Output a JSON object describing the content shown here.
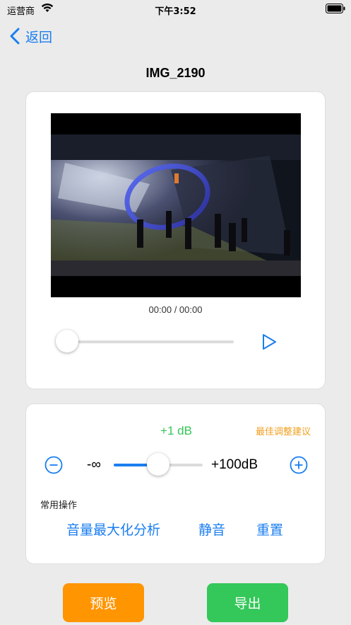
{
  "status_bar": {
    "carrier": "运营商",
    "time": "下午3:52"
  },
  "nav": {
    "back_label": "返回"
  },
  "page": {
    "title": "IMG_2190"
  },
  "player": {
    "timecode": "00:00 / 00:00",
    "progress": 0
  },
  "volume": {
    "gain_label": "+1 dB",
    "best_suggestion": "最佳调整建议",
    "min_label": "-∞",
    "max_label": "+100dB",
    "slider_fraction": 0.5,
    "common_ops_label": "常用操作",
    "actions": [
      "音量最大化分析",
      "静音",
      "重置"
    ]
  },
  "buttons": {
    "preview": "预览",
    "export": "导出"
  },
  "colors": {
    "accent": "#1a7ef0",
    "green": "#34c759",
    "orange": "#ff9500",
    "suggest": "#f0a020"
  }
}
